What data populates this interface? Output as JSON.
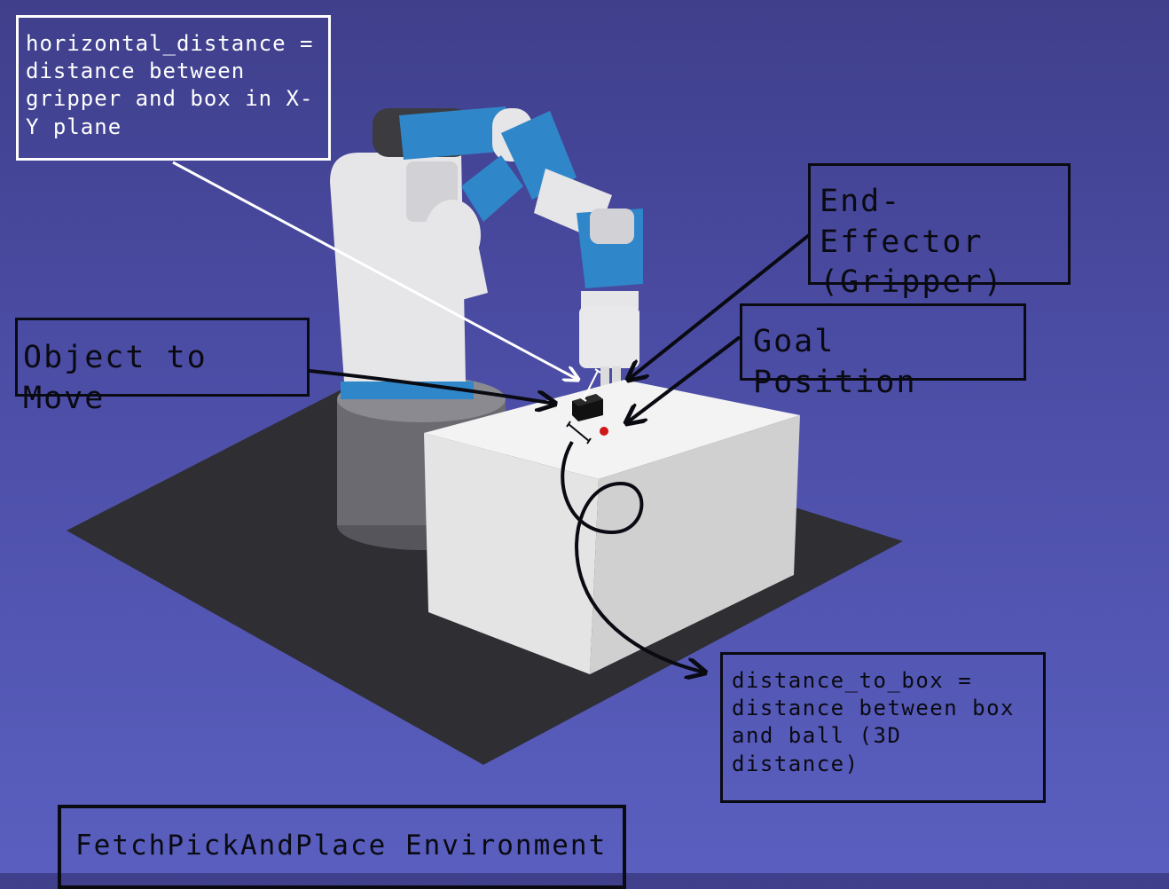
{
  "annotations": {
    "horizontal_distance": "horizontal_distance = distance between gripper and box in X-Y plane",
    "end_effector": "End-Effector (Gripper)",
    "goal_position": "Goal Position",
    "object_to_move": "Object to Move",
    "distance_to_box": "distance_to_box = distance between box and ball (3D distance)",
    "environment_title": "FetchPickAndPlace Environment"
  },
  "colors": {
    "background_top": "#3f3f8c",
    "background_bottom": "#5a5fbf",
    "robot_white": "#e6e6e8",
    "robot_blue": "#2f87c9",
    "robot_dark": "#3b3b40",
    "table_white": "#f2f2f2",
    "floor": "#2e2e33",
    "goal_ball": "#d01616",
    "object_box": "#111111"
  }
}
